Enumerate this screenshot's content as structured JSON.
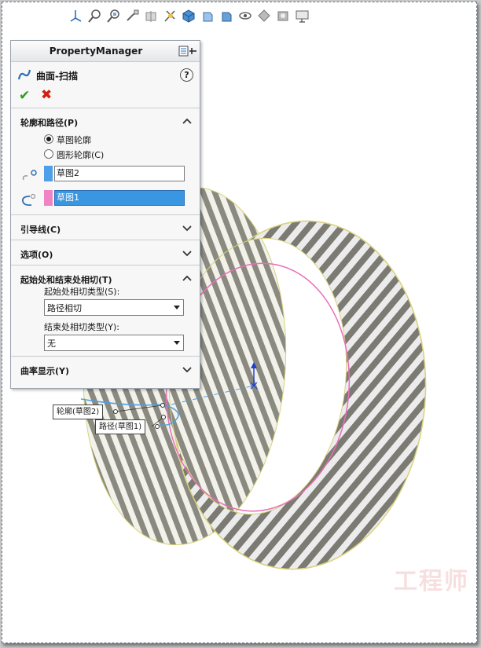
{
  "toolbar": {
    "icons": [
      "view-orient-icon",
      "zoom-to-fit-icon",
      "zoom-area-icon",
      "previous-view-icon",
      "section-view-icon",
      "dynamic-annotation-icon",
      "view-orientation-cube-icon",
      "display-style-icon",
      "hide-show-icon",
      "edit-appearance-icon",
      "apply-scene-icon",
      "view-settings-icon",
      "monitor-icon"
    ]
  },
  "property_manager": {
    "title": "PropertyManager",
    "feature_name": "曲面-扫描",
    "help": "?",
    "ok": "✔",
    "cancel": "✖",
    "sections": {
      "profile_path": {
        "label": "轮廓和路径(P)",
        "radio_sketch": "草图轮廓",
        "radio_circle": "圆形轮廓(C)",
        "profile_value": "草图2",
        "path_value": "草图1",
        "profile_color": "#4f9ee9",
        "path_color": "#ef83c4"
      },
      "guide": {
        "label": "引导线(C)"
      },
      "options": {
        "label": "选项(O)"
      },
      "tangency": {
        "label": "起始处和结束处相切(T)",
        "start_label": "起始处相切类型(S):",
        "start_value": "路径相切",
        "end_label": "结束处相切类型(Y):",
        "end_value": "无"
      },
      "curvature": {
        "label": "曲率显示(Y)"
      }
    }
  },
  "callouts": {
    "profile": "轮廓(草图2)",
    "path": "路径(草图1)"
  },
  "watermark": "工程师"
}
